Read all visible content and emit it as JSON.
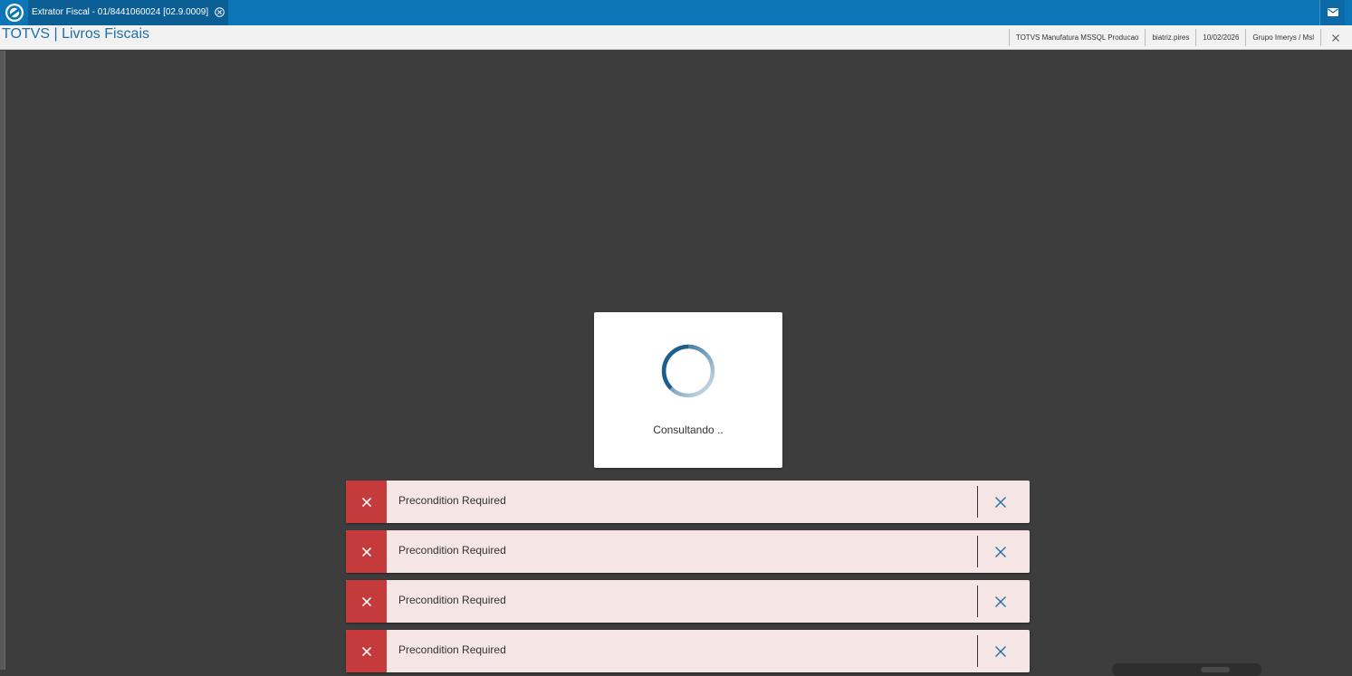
{
  "window": {
    "tab_title": "Extrator Fiscal - 01/8441060024 [02.9.0009]"
  },
  "header": {
    "title": "TOTVS | Livros Fiscais",
    "info": [
      "TOTVS Manufatura MSSQL Producao",
      "biatriz.pires",
      "10/02/2026",
      "Grupo Imerys / Msl"
    ]
  },
  "loader": {
    "text": "Consultando .."
  },
  "toasts": [
    {
      "message": "Precondition Required"
    },
    {
      "message": "Precondition Required"
    },
    {
      "message": "Precondition Required"
    },
    {
      "message": "Precondition Required"
    }
  ],
  "colors": {
    "topbar": "#0a76b8",
    "title": "#1f6fa8",
    "error": "#c53a3a",
    "toast_bg": "#f6e5e5",
    "backdrop": "#3d3d3d"
  },
  "icons": {
    "app_logo": "totvs-logo-icon",
    "tab_close": "close-circle-icon",
    "mail": "mail-icon",
    "toast_error": "error-x-icon",
    "toast_close": "close-icon"
  }
}
